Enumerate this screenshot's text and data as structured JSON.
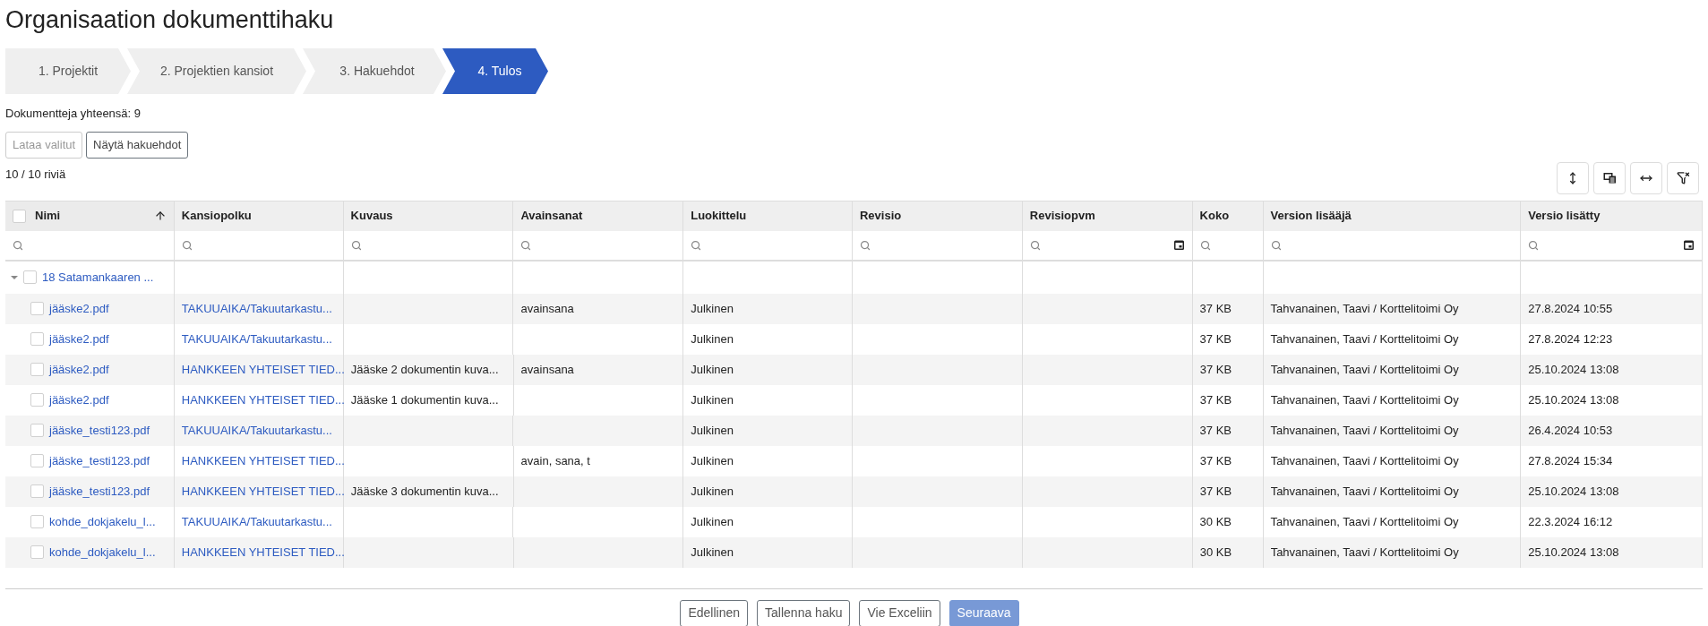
{
  "title": "Organisaation dokumenttihaku",
  "steps": [
    {
      "label": "1. Projektit",
      "selected": false
    },
    {
      "label": "2. Projektien kansiot",
      "selected": false
    },
    {
      "label": "3. Hakuehdot",
      "selected": false
    },
    {
      "label": "4. Tulos",
      "selected": true
    }
  ],
  "total": "Dokumentteja yhteensä: 9",
  "actions": [
    {
      "label": "Lataa valitut",
      "disabled": true
    },
    {
      "label": "Näytä hakuehdot",
      "disabled": false
    }
  ],
  "row_count": "10 / 10 riviä",
  "toolbar": [
    {
      "kind": "density"
    },
    {
      "kind": "columns"
    },
    {
      "kind": "width"
    },
    {
      "kind": "clear-filters"
    }
  ],
  "table": {
    "select_all": {
      "checked": false
    },
    "columns": [
      {
        "label": "Nimi",
        "sorted": true,
        "kind": "text"
      },
      {
        "label": "Kansiopolku",
        "sorted": false,
        "kind": "text"
      },
      {
        "label": "Kuvaus",
        "sorted": false,
        "kind": "text"
      },
      {
        "label": "Avainsanat",
        "sorted": false,
        "kind": "text"
      },
      {
        "label": "Luokittelu",
        "sorted": false,
        "kind": "text"
      },
      {
        "label": "Revisio",
        "sorted": false,
        "kind": "text"
      },
      {
        "label": "Revisiopvm",
        "sorted": false,
        "kind": "date"
      },
      {
        "label": "Koko",
        "sorted": false,
        "kind": "text"
      },
      {
        "label": "Version lisääjä",
        "sorted": false,
        "kind": "text"
      },
      {
        "label": "Versio lisätty",
        "sorted": false,
        "kind": "date"
      }
    ],
    "group": {
      "label": "18 Satamankaaren ...",
      "expanded": true,
      "checked": false
    },
    "rows": [
      {
        "checked": false,
        "cells": [
          "jääske2.pdf",
          "TAKUUAIKA/Takuutarkastu...",
          "",
          "avainsana",
          "Julkinen",
          "",
          "",
          "37 KB",
          "Tahvanainen, Taavi / Korttelitoimi Oy",
          "27.8.2024 10:55"
        ]
      },
      {
        "checked": false,
        "cells": [
          "jääske2.pdf",
          "TAKUUAIKA/Takuutarkastu...",
          "",
          "",
          "Julkinen",
          "",
          "",
          "37 KB",
          "Tahvanainen, Taavi / Korttelitoimi Oy",
          "27.8.2024 12:23"
        ]
      },
      {
        "checked": false,
        "cells": [
          "jääske2.pdf",
          "HANKKEEN YHTEISET TIED...",
          "Jääske 2 dokumentin kuva...",
          "avainsana",
          "Julkinen",
          "",
          "",
          "37 KB",
          "Tahvanainen, Taavi / Korttelitoimi Oy",
          "25.10.2024 13:08"
        ]
      },
      {
        "checked": false,
        "cells": [
          "jääske2.pdf",
          "HANKKEEN YHTEISET TIED...",
          "Jääske 1 dokumentin kuva...",
          "",
          "Julkinen",
          "",
          "",
          "37 KB",
          "Tahvanainen, Taavi / Korttelitoimi Oy",
          "25.10.2024 13:08"
        ]
      },
      {
        "checked": false,
        "cells": [
          "jääske_testi123.pdf",
          "TAKUUAIKA/Takuutarkastu...",
          "",
          "",
          "Julkinen",
          "",
          "",
          "37 KB",
          "Tahvanainen, Taavi / Korttelitoimi Oy",
          "26.4.2024 10:53"
        ]
      },
      {
        "checked": false,
        "cells": [
          "jääske_testi123.pdf",
          "HANKKEEN YHTEISET TIED...",
          "",
          "avain, sana, t",
          "Julkinen",
          "",
          "",
          "37 KB",
          "Tahvanainen, Taavi / Korttelitoimi Oy",
          "27.8.2024 15:34"
        ]
      },
      {
        "checked": false,
        "cells": [
          "jääske_testi123.pdf",
          "HANKKEEN YHTEISET TIED...",
          "Jääske 3 dokumentin kuva...",
          "",
          "Julkinen",
          "",
          "",
          "37 KB",
          "Tahvanainen, Taavi / Korttelitoimi Oy",
          "25.10.2024 13:08"
        ]
      },
      {
        "checked": false,
        "cells": [
          "kohde_dokjakelu_l...",
          "TAKUUAIKA/Takuutarkastu...",
          "",
          "",
          "Julkinen",
          "",
          "",
          "30 KB",
          "Tahvanainen, Taavi / Korttelitoimi Oy",
          "22.3.2024 16:12"
        ]
      },
      {
        "checked": false,
        "cells": [
          "kohde_dokjakelu_l...",
          "HANKKEEN YHTEISET TIED...",
          "",
          "",
          "Julkinen",
          "",
          "",
          "30 KB",
          "Tahvanainen, Taavi / Korttelitoimi Oy",
          "25.10.2024 13:08"
        ]
      }
    ]
  },
  "footer": [
    {
      "label": "Edellinen",
      "kind": "outline",
      "disabled": false
    },
    {
      "label": "Tallenna haku",
      "kind": "outline",
      "disabled": false
    },
    {
      "label": "Vie Exceliin",
      "kind": "outline",
      "disabled": false
    },
    {
      "label": "Seuraava",
      "kind": "primary",
      "disabled": true
    }
  ]
}
